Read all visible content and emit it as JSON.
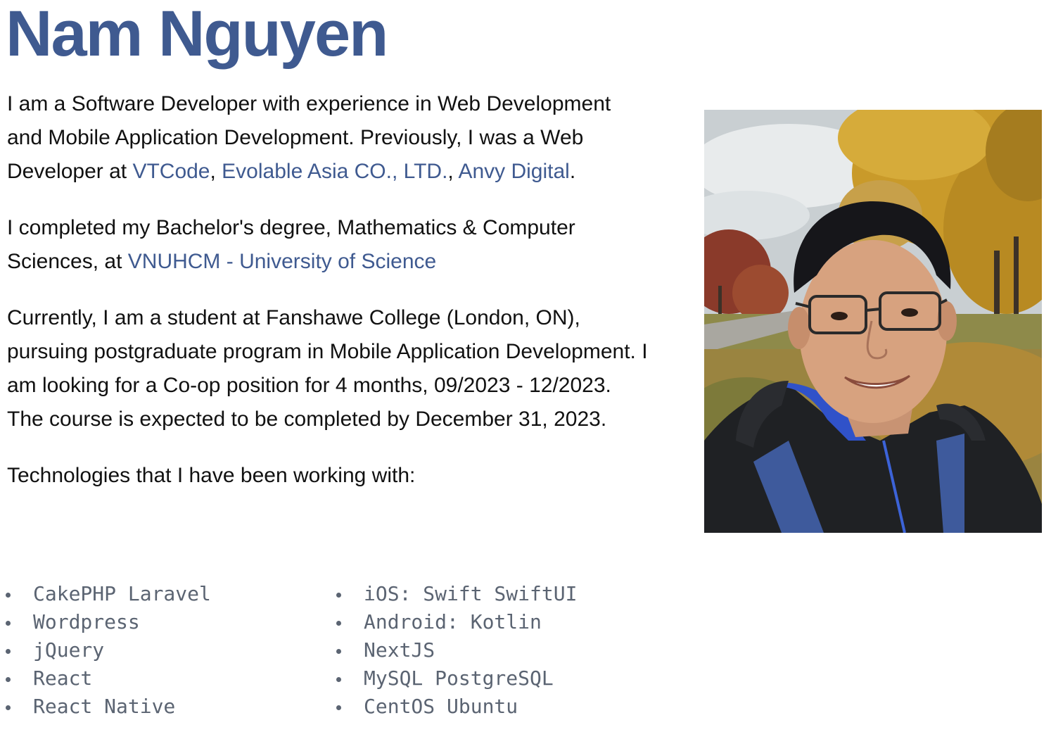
{
  "header": {
    "name": "Nam Nguyen"
  },
  "intro": {
    "p1_part1": "I am a Software Developer with experience in Web Development and Mobile Application Development. Previously, I was a Web Developer at ",
    "link_vtcode": "VTCode",
    "sep1": ", ",
    "link_evolable": "Evolable Asia CO., LTD.",
    "sep2": ", ",
    "link_anvy": "Anvy Digital",
    "end1": ".",
    "p2_part1": "I completed my Bachelor's degree, Mathematics & Computer Sciences, at ",
    "link_vnuhcm": "VNUHCM - University of Science",
    "p3": "Currently, I am a student at Fanshawe College (London, ON), pursuing postgraduate program in Mobile Application Development. I am looking for a Co-op position for 4 months, 09/2023 - 12/2023. The course is expected to be completed by December 31, 2023.",
    "tech_intro": "Technologies that I have been working with:"
  },
  "technologies": {
    "left": [
      "CakePHP Laravel",
      "Wordpress",
      "jQuery",
      "React",
      "React Native"
    ],
    "right": [
      "iOS: Swift SwiftUI",
      "Android: Kotlin",
      "NextJS",
      "MySQL PostgreSQL",
      "CentOS Ubuntu"
    ]
  },
  "colors": {
    "accent": "#3f5a90",
    "body_text": "#111111",
    "list_text": "#5b6472"
  }
}
